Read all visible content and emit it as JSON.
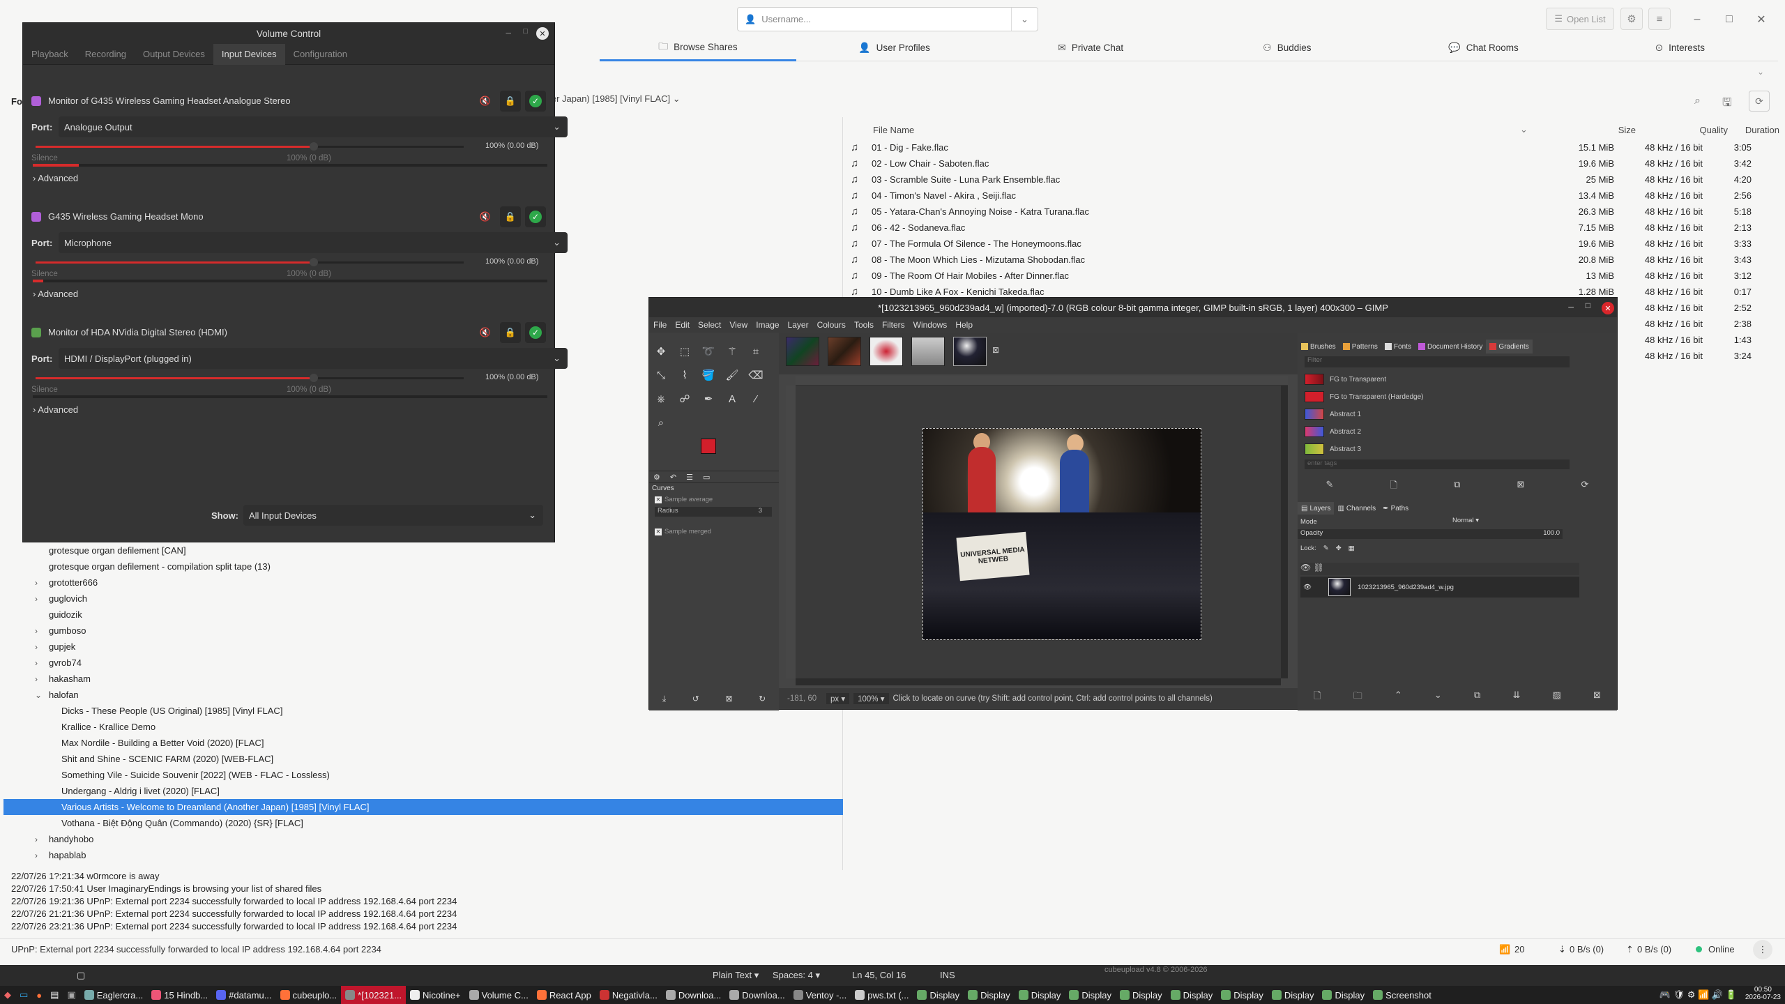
{
  "nicotine": {
    "username_placeholder": "Username...",
    "open_list": "Open List",
    "tabs": [
      {
        "label": "Browse Shares",
        "icon": "folder-icon"
      },
      {
        "label": "User Profiles",
        "icon": "person-icon"
      },
      {
        "label": "Private Chat",
        "icon": "mail-icon"
      },
      {
        "label": "Buddies",
        "icon": "buddies-icon"
      },
      {
        "label": "Chat Rooms",
        "icon": "chat-icon"
      },
      {
        "label": "Interests",
        "icon": "interests-icon"
      }
    ],
    "left_header": "Fo",
    "path": "ther Japan) [1985] [Vinyl FLAC]",
    "file_headers": {
      "name": "File Name",
      "size": "Size",
      "quality": "Quality",
      "duration": "Duration"
    },
    "files": [
      {
        "name": "01 - Dig - Fake.flac",
        "size": "15.1 MiB",
        "quality": "48 kHz / 16 bit",
        "duration": "3:05"
      },
      {
        "name": "02 - Low Chair - Saboten.flac",
        "size": "19.6 MiB",
        "quality": "48 kHz / 16 bit",
        "duration": "3:42"
      },
      {
        "name": "03 - Scramble Suite - Luna Park Ensemble.flac",
        "size": "25 MiB",
        "quality": "48 kHz / 16 bit",
        "duration": "4:20"
      },
      {
        "name": "04 - Timon's Navel - Akira , Seiji.flac",
        "size": "13.4 MiB",
        "quality": "48 kHz / 16 bit",
        "duration": "2:56"
      },
      {
        "name": "05 - Yatara-Chan's Annoying Noise - Katra Turana.flac",
        "size": "26.3 MiB",
        "quality": "48 kHz / 16 bit",
        "duration": "5:18"
      },
      {
        "name": "06 - 42 - Sodaneva.flac",
        "size": "7.15 MiB",
        "quality": "48 kHz / 16 bit",
        "duration": "2:13"
      },
      {
        "name": "07 - The Formula Of Silence - The Honeymoons.flac",
        "size": "19.6 MiB",
        "quality": "48 kHz / 16 bit",
        "duration": "3:33"
      },
      {
        "name": "08 - The Moon Which Lies - Mizutama Shobodan.flac",
        "size": "20.8 MiB",
        "quality": "48 kHz / 16 bit",
        "duration": "3:43"
      },
      {
        "name": "09 - The Room Of Hair Mobiles - After Dinner.flac",
        "size": "13 MiB",
        "quality": "48 kHz / 16 bit",
        "duration": "3:12"
      },
      {
        "name": "10 - Dumb Like A Fox - Kenichi Takeda.flac",
        "size": "1.28 MiB",
        "quality": "48 kHz / 16 bit",
        "duration": "0:17"
      },
      {
        "name": "",
        "size": "",
        "quality": "48 kHz / 16 bit",
        "duration": "2:52"
      },
      {
        "name": "",
        "size": "",
        "quality": "48 kHz / 16 bit",
        "duration": "2:38"
      },
      {
        "name": "",
        "size": "",
        "quality": "48 kHz / 16 bit",
        "duration": "1:43"
      },
      {
        "name": "",
        "size": "",
        "quality": "48 kHz / 16 bit",
        "duration": "3:24"
      }
    ],
    "tree": [
      {
        "label": "grotesque  organ  defilement [CAN]",
        "level": 1,
        "exp": ""
      },
      {
        "label": "grotesque organ defilement - compilation split tape (13)",
        "level": 1,
        "exp": ""
      },
      {
        "label": "grototter666",
        "level": 1,
        "exp": ">"
      },
      {
        "label": "guglovich",
        "level": 1,
        "exp": ">"
      },
      {
        "label": "guidozik",
        "level": 1,
        "exp": ""
      },
      {
        "label": "gumboso",
        "level": 1,
        "exp": ">"
      },
      {
        "label": "gupjek",
        "level": 1,
        "exp": ">"
      },
      {
        "label": "gvrob74",
        "level": 1,
        "exp": ">"
      },
      {
        "label": "hakasham",
        "level": 1,
        "exp": ">"
      },
      {
        "label": "halofan",
        "level": 1,
        "exp": "v"
      },
      {
        "label": "Dicks - These People (US Original) [1985] [Vinyl FLAC]",
        "level": 2,
        "exp": ""
      },
      {
        "label": "Krallice - Krallice Demo",
        "level": 2,
        "exp": ""
      },
      {
        "label": "Max Nordile - Building a Better Void (2020) [FLAC]",
        "level": 2,
        "exp": ""
      },
      {
        "label": "Shit and Shine - SCENIC FARM (2020) [WEB-FLAC]",
        "level": 2,
        "exp": ""
      },
      {
        "label": "Something Vile - Suicide Souvenir [2022] (WEB - FLAC - Lossless)",
        "level": 2,
        "exp": ""
      },
      {
        "label": "Undergang - Aldrig i livet (2020) [FLAC]",
        "level": 2,
        "exp": ""
      },
      {
        "label": "Various Artists - Welcome to Dreamland (Another Japan) [1985] [Vinyl FLAC]",
        "level": 2,
        "exp": "",
        "selected": true
      },
      {
        "label": "Vothana - Biệt Động Quân (Commando) (2020) {SR} [FLAC]",
        "level": 2,
        "exp": ""
      },
      {
        "label": "handyhobo",
        "level": 1,
        "exp": ">"
      },
      {
        "label": "hapablab",
        "level": 1,
        "exp": ">"
      }
    ],
    "log": [
      "22/07/26 1?:21:34 w0rmcore is away",
      "22/07/26 17:50:41 User ImaginaryEndings is browsing your list of shared files",
      "22/07/26 19:21:36 UPnP: External port 2234 successfully forwarded to local IP address 192.168.4.64 port 2234",
      "22/07/26 21:21:36 UPnP: External port 2234 successfully forwarded to local IP address 192.168.4.64 port 2234",
      "22/07/26 23:21:36 UPnP: External port 2234 successfully forwarded to local IP address 192.168.4.64 port 2234"
    ],
    "status_text": "UPnP: External port 2234 successfully forwarded to local IP address 192.168.4.64 port 2234",
    "status_users": "20",
    "status_down": "0 B/s (0)",
    "status_up": "0 B/s (0)",
    "status_online": "Online"
  },
  "editor_bar": {
    "lang": "Plain Text",
    "spaces": "Spaces: 4",
    "pos": "Ln 45, Col 16",
    "mode": "INS",
    "cube": "cubeupload v4.8 © 2006-2026"
  },
  "volume": {
    "title": "Volume Control",
    "tabs": [
      "Playback",
      "Recording",
      "Output Devices",
      "Input Devices",
      "Configuration"
    ],
    "active_tab": "Input Devices",
    "devices": [
      {
        "name": "Monitor of G435 Wireless Gaming Headset Analogue Stereo",
        "port": "Analogue Output",
        "pct": "100% (0.00 dB)",
        "level": 1.0,
        "peak": 0.09,
        "locked": true,
        "icon_color": "#b05fd8"
      },
      {
        "name": "G435 Wireless Gaming Headset Mono",
        "port": "Microphone",
        "pct": "100% (0.00 dB)",
        "level": 1.0,
        "peak": 0.02,
        "locked": false,
        "icon_color": "#b05fd8"
      },
      {
        "name": "Monitor of HDA NVidia Digital Stereo (HDMI)",
        "port": "HDMI / DisplayPort (plugged in)",
        "pct": "100% (0.00 dB)",
        "level": 1.0,
        "peak": 0.0,
        "locked": true,
        "icon_color": "#5aa04d"
      }
    ],
    "port_label": "Port:",
    "silence": "Silence",
    "zero_db": "100% (0 dB)",
    "advanced": "Advanced",
    "show_label": "Show:",
    "show_value": "All Input Devices"
  },
  "gimp": {
    "title": "*[1023213965_960d239ad4_w] (imported)-7.0 (RGB colour 8-bit gamma integer, GIMP built-in sRGB, 1 layer) 400x300 – GIMP",
    "menu": [
      "File",
      "Edit",
      "Select",
      "View",
      "Image",
      "Layer",
      "Colours",
      "Tools",
      "Filters",
      "Windows",
      "Help"
    ],
    "dock_tabs": [
      "Brushes",
      "Patterns",
      "Fonts",
      "Document History",
      "Gradients"
    ],
    "gradients": [
      {
        "name": "FG to Transparent",
        "colors": "#d21f2b,#7a1118"
      },
      {
        "name": "FG to Transparent (Hardedge)",
        "colors": "#d21f2b,#d21f2b"
      },
      {
        "name": "Abstract 1",
        "colors": "#3e59d8,#d24646"
      },
      {
        "name": "Abstract 2",
        "colors": "#d83a6e,#3e59d8"
      },
      {
        "name": "Abstract 3",
        "colors": "#7fb93c,#d2c13e"
      }
    ],
    "filter_placeholder": "Filter",
    "tag_placeholder": "enter tags",
    "layer_tabs": [
      "Layers",
      "Channels",
      "Paths"
    ],
    "mode_label": "Mode",
    "mode_value": "Normal",
    "opacity_label": "Opacity",
    "opacity_value": "100.0",
    "lock_label": "Lock:",
    "layer_name": "1023213965_960d239ad4_w.jpg",
    "curves_title": "Curves",
    "sample_average": "Sample average",
    "radius_label": "Radius",
    "radius_value": "3",
    "sample_merged": "Sample merged",
    "coords": "-181, 60",
    "unit": "px",
    "zoom": "100%",
    "hint": "Click to locate on curve (try Shift: add control point, Ctrl: add control points to all channels)",
    "sign_text": "UNIVERSAL MEDIA NETWEB"
  },
  "taskbar": [
    {
      "label": "Eaglercra...",
      "color": "#7aa"
    },
    {
      "label": "15 Hindb...",
      "color": "#e57"
    },
    {
      "label": "#datamu...",
      "color": "#5865f2"
    },
    {
      "label": "cubeuplo...",
      "color": "#ff7139"
    },
    {
      "label": "*[102321...",
      "color": "#888",
      "hot": true
    },
    {
      "label": "Nicotine+",
      "color": "#eee"
    },
    {
      "label": "Volume C...",
      "color": "#aaa"
    },
    {
      "label": "React App",
      "color": "#ff7139"
    },
    {
      "label": "Negativla...",
      "color": "#c33"
    },
    {
      "label": "Downloa...",
      "color": "#aaa"
    },
    {
      "label": "Downloa...",
      "color": "#aaa"
    },
    {
      "label": "Ventoy -...",
      "color": "#888"
    },
    {
      "label": "pws.txt (...",
      "color": "#ccc"
    },
    {
      "label": "Display",
      "color": "#6a6"
    },
    {
      "label": "Display",
      "color": "#6a6"
    },
    {
      "label": "Display",
      "color": "#6a6"
    },
    {
      "label": "Display",
      "color": "#6a6"
    },
    {
      "label": "Display",
      "color": "#6a6"
    },
    {
      "label": "Display",
      "color": "#6a6"
    },
    {
      "label": "Display",
      "color": "#6a6"
    },
    {
      "label": "Display",
      "color": "#6a6"
    },
    {
      "label": "Display",
      "color": "#6a6"
    },
    {
      "label": "Screenshot",
      "color": "#6a6"
    }
  ],
  "clock": {
    "time": "00:50",
    "date": "2026-07-23"
  }
}
